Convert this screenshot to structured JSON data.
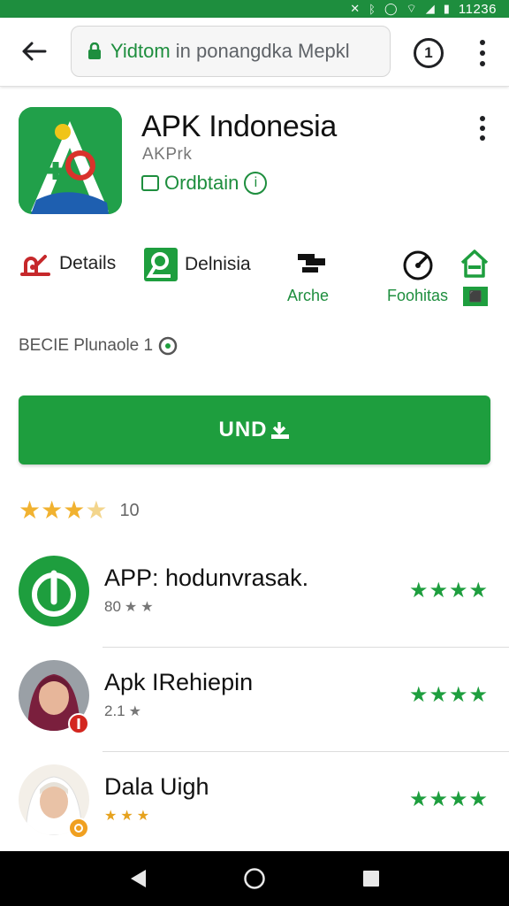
{
  "status_bar": {
    "time": "11236",
    "icons": [
      "mute-icon",
      "bluetooth-icon",
      "alarm-icon",
      "wifi-icon",
      "signal-icon",
      "battery-icon"
    ]
  },
  "browser": {
    "url_host": "Yidtom",
    "url_rest": " in ponangdka Mepkl",
    "tabs_count": "1"
  },
  "app": {
    "title": "APK Indonesia",
    "developer": "AKPrk",
    "badge": "Ordbtain"
  },
  "actions": [
    {
      "label": "Details",
      "icon": "hand-icon"
    },
    {
      "label": "Delnisia",
      "icon": "search-icon"
    },
    {
      "label": "",
      "sub": "Arche",
      "icon": "archive-icon"
    },
    {
      "label": "",
      "sub": "Foohitas",
      "icon": "gauge-icon"
    },
    {
      "label": "",
      "sub": "",
      "icon": "home-icon"
    }
  ],
  "meta_line": "BECIE Plunaole 1",
  "install": {
    "label": "UND"
  },
  "rating": {
    "stars": 3.5,
    "count": "10"
  },
  "list": [
    {
      "title": "APP: hodunvrasak.",
      "sub": "80",
      "stars": 4
    },
    {
      "title": "Apk IRehiepin",
      "sub": "2.1",
      "stars": 4
    },
    {
      "title": "Dala Uigh",
      "sub": "",
      "stars": 4
    }
  ],
  "colors": {
    "brand_green": "#1e9e3e",
    "status_green": "#1e8e3e",
    "star_gold": "#f1b230"
  }
}
